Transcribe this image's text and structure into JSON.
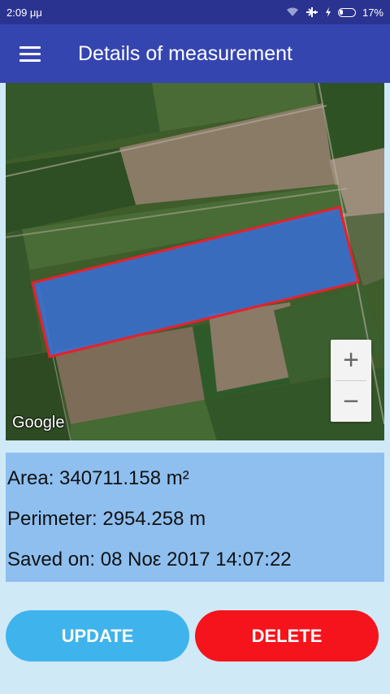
{
  "status_bar": {
    "time": "2:09 μμ",
    "battery": "17%",
    "icons": [
      "wifi-icon",
      "airplane-icon",
      "charging-icon",
      "battery-icon"
    ]
  },
  "app_bar": {
    "menu_icon": "menu-icon",
    "title": "Details of measurement"
  },
  "map": {
    "attribution": "Google",
    "zoom_in": "+",
    "zoom_out": "−",
    "polygon_fill": "#3a6fd8",
    "polygon_stroke": "#e8202a"
  },
  "info": {
    "area": "Area: 340711.158 m²",
    "perimeter": "Perimeter: 2954.258 m",
    "saved_on": "Saved on: 08 Νοε 2017 14:07:22"
  },
  "buttons": {
    "update": "UPDATE",
    "delete": "DELETE"
  }
}
